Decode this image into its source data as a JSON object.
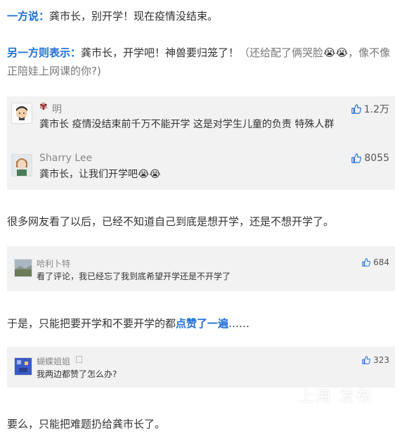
{
  "p1": {
    "label": "一方说",
    "colon": "：",
    "text": "龚市长，别开学！现在疫情没结束。"
  },
  "p2": {
    "label": "另一方则表示",
    "colon": "：",
    "text": "龚市长，开学吧！神兽要归笼了！",
    "note": "（还给配了俩哭脸",
    "note_end": "，像不像正陪娃上网课的你?)",
    "emoji": "😭😭"
  },
  "comments1": [
    {
      "name": "明",
      "text": "龚市长 疫情没结束前千万不能开学 这是对学生儿童的负责 特殊人群",
      "likes": "1.2万"
    },
    {
      "name": "Sharry Lee",
      "text": "龚市长，让我们开学吧",
      "emoji": "😭😭",
      "likes": "8055"
    }
  ],
  "p3": "很多网友看了以后，已经不知道自己到底是想开学，还是不想开学了。",
  "comment2": {
    "name": "哈利卜特",
    "text": "看了评论，我已经忘了我到底希望开学还是不开学了",
    "likes": "684"
  },
  "p4": {
    "text": "于是，只能把要开学和不要开学的都",
    "highlight": "点赞了一遍",
    "tail": "……"
  },
  "comment3": {
    "name": "蝴蝶姐姐",
    "text": "我两边都赞了怎么办?",
    "likes": "323"
  },
  "p5": "要么，只能把难题扔给龚市长了。",
  "watermark": "上海 发布",
  "colors": {
    "accent": "#1e6fd9",
    "box": "#f2f2f2"
  }
}
